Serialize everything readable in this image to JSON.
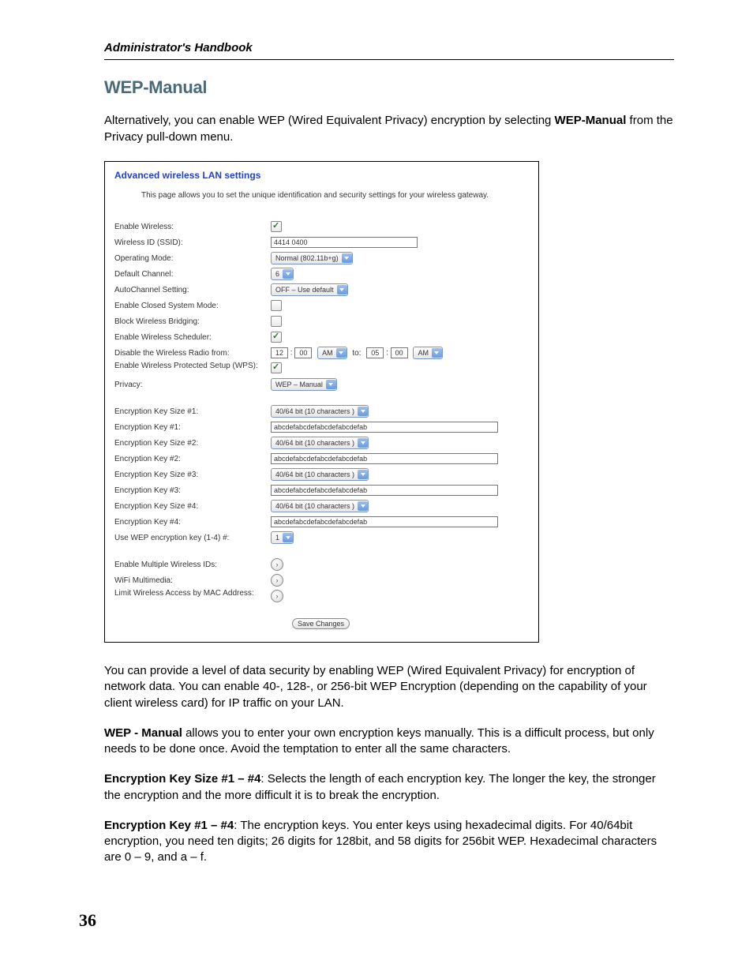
{
  "header": {
    "running": "Administrator's Handbook"
  },
  "title": "WEP-Manual",
  "intro": {
    "line1": "Alternatively, you can enable WEP (Wired Equivalent Privacy) encryption by selecting ",
    "bold": "WEP-Manual",
    "line2": " from the Privacy pull-down menu."
  },
  "panel": {
    "title": "Advanced wireless LAN settings",
    "desc": "This page allows you to set the unique identification and security settings for your wireless gateway.",
    "rows": {
      "enable_wireless": "Enable Wireless:",
      "ssid_label": "Wireless ID (SSID):",
      "ssid_value": "4414 0400",
      "mode_label": "Operating Mode:",
      "mode_value": "Normal (802.11b+g)",
      "channel_label": "Default Channel:",
      "channel_value": "6",
      "auto_label": "AutoChannel Setting:",
      "auto_value": "OFF – Use default",
      "closed_label": "Enable Closed System Mode:",
      "block_label": "Block Wireless Bridging:",
      "sched_label": "Enable Wireless Scheduler:",
      "disable_label": "Disable the Wireless Radio from:",
      "disable_h1": "12",
      "disable_m1": "00",
      "disable_ampm1": "AM",
      "disable_to": "to:",
      "disable_h2": "05",
      "disable_m2": "00",
      "disable_ampm2": "AM",
      "wps_label": "Enable Wireless Protected Setup (WPS):",
      "privacy_label": "Privacy:",
      "privacy_value": "WEP – Manual",
      "ksize1": "Encryption Key Size #1:",
      "ksize2": "Encryption Key Size #2:",
      "ksize3": "Encryption Key Size #3:",
      "ksize4": "Encryption Key Size #4:",
      "ksize_value": "40/64 bit (10 characters )",
      "key1": "Encryption Key #1:",
      "key2": "Encryption Key #2:",
      "key3": "Encryption Key #3:",
      "key4": "Encryption Key #4:",
      "key_value": "abcdefabcdefabcdefabcdefab",
      "usekey_label": "Use WEP encryption key (1-4) #:",
      "usekey_value": "1",
      "multi_label": "Enable Multiple Wireless IDs:",
      "wifi_label": "WiFi Multimedia:",
      "mac_label": "Limit Wireless Access by MAC Address:",
      "save": "Save Changes"
    }
  },
  "body": {
    "p1": "You can provide a level of data security by enabling WEP (Wired Equivalent Privacy) for encryption of network data. You can enable 40-, 128-, or 256-bit WEP Encryption (depending on the capability of your client wireless card) for IP traffic on your LAN.",
    "p2a": "WEP - Manual",
    "p2b": " allows you to enter your own encryption keys manually. This is a difficult process, but only needs to be done once. Avoid the temptation to enter all the same characters.",
    "p3a": "Encryption Key Size #1 – #4",
    "p3b": ": Selects the length of each encryption key. The longer the key, the stronger the encryption and the more difficult it is to break the encryption.",
    "p4a": "Encryption Key #1 – #4",
    "p4b": ": The encryption keys. You enter keys using hexadecimal digits. For 40/64bit encryption, you need ten digits; 26 digits for 128bit, and 58 digits for 256bit WEP. Hexadecimal characters are 0 – 9, and a – f."
  },
  "page_number": "36"
}
